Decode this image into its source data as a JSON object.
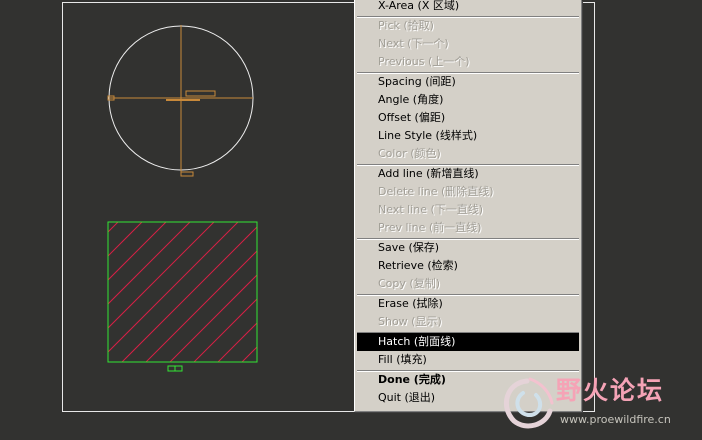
{
  "menu": {
    "items": [
      {
        "label": "X-Area (X 区域)",
        "enabled": true
      },
      {
        "separator": true
      },
      {
        "label": "Pick (拾取)",
        "enabled": false
      },
      {
        "label": "Next (下一个)",
        "enabled": false
      },
      {
        "label": "Previous (上一个)",
        "enabled": false
      },
      {
        "separator": true
      },
      {
        "label": "Spacing (间距)",
        "enabled": true
      },
      {
        "label": "Angle (角度)",
        "enabled": true
      },
      {
        "label": "Offset (偏距)",
        "enabled": true
      },
      {
        "label": "Line Style (线样式)",
        "enabled": true
      },
      {
        "label": "Color (颜色)",
        "enabled": false
      },
      {
        "separator": true
      },
      {
        "label": "Add line (新增直线)",
        "enabled": true
      },
      {
        "label": "Delete line (删除直线)",
        "enabled": false
      },
      {
        "label": "Next line (下一直线)",
        "enabled": false
      },
      {
        "label": "Prev line (前一直线)",
        "enabled": false
      },
      {
        "separator": true
      },
      {
        "label": "Save (保存)",
        "enabled": true
      },
      {
        "label": "Retrieve (检索)",
        "enabled": true
      },
      {
        "label": "Copy (复制)",
        "enabled": false
      },
      {
        "separator": true
      },
      {
        "label": "Erase (拭除)",
        "enabled": true
      },
      {
        "label": "Show (显示)",
        "enabled": false
      },
      {
        "separator": true
      },
      {
        "label": "Hatch (剖面线)",
        "enabled": true,
        "selected": true
      },
      {
        "label": "Fill (填充)",
        "enabled": true
      },
      {
        "separator": true
      },
      {
        "label": "Done (完成)",
        "enabled": true,
        "bold": true
      },
      {
        "label": "Quit (退出)",
        "enabled": true
      }
    ]
  },
  "watermark": {
    "title": "野火论坛",
    "url": "www.proewildfire.cn"
  },
  "colors": {
    "background": "#323230",
    "frame": "#e8e8e8",
    "circle": "#f0f0f0",
    "axis": "#c8893a",
    "section_border": "#33e533",
    "hatch": "#d62045",
    "menu_bg": "#d4d0c8",
    "selected_bg": "#000000"
  }
}
